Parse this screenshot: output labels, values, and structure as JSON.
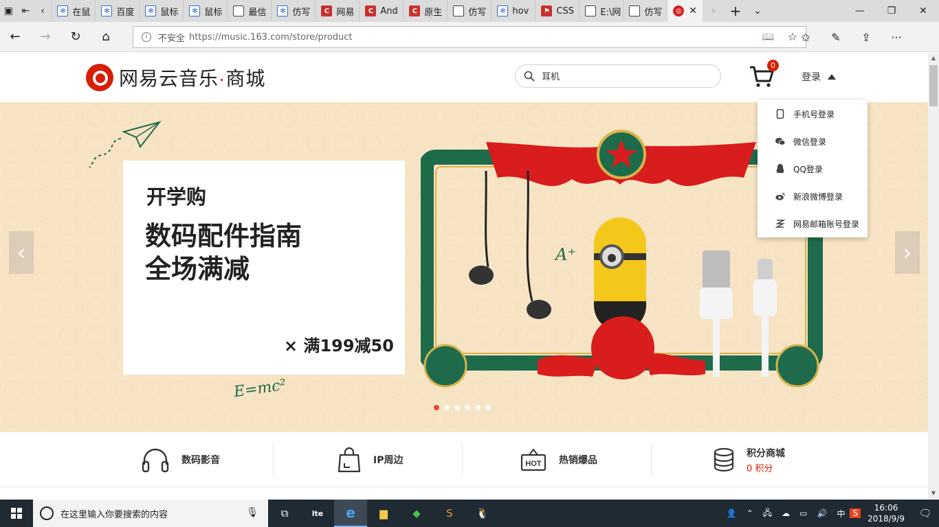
{
  "browser": {
    "tabs": [
      {
        "title": "在鼠",
        "icon": "paw"
      },
      {
        "title": "百度",
        "icon": "paw"
      },
      {
        "title": "鼠标",
        "icon": "paw"
      },
      {
        "title": "鼠标",
        "icon": "paw"
      },
      {
        "title": "最信",
        "icon": "page"
      },
      {
        "title": "仿写",
        "icon": "paw"
      },
      {
        "title": "网易",
        "icon": "csdn"
      },
      {
        "title": "And",
        "icon": "csdn"
      },
      {
        "title": "原生",
        "icon": "csdn"
      },
      {
        "title": "仿写",
        "icon": "page"
      },
      {
        "title": "hov",
        "icon": "paw"
      },
      {
        "title": "CSS",
        "icon": "ext"
      },
      {
        "title": "E:\\网",
        "icon": "page"
      },
      {
        "title": "仿写",
        "icon": "page"
      }
    ],
    "insecure_label": "不安全",
    "url": "https://music.163.com/store/product"
  },
  "site": {
    "logo_name": "网易云音乐",
    "logo_dot": "·",
    "logo_suffix": "商城",
    "search_placeholder": "耳机",
    "cart_count": "0",
    "login_label": "登录",
    "login_menu": [
      {
        "label": "手机号登录",
        "icon": "phone-icon"
      },
      {
        "label": "微信登录",
        "icon": "wechat-icon"
      },
      {
        "label": "QQ登录",
        "icon": "qq-icon"
      },
      {
        "label": "新浪微博登录",
        "icon": "weibo-icon"
      },
      {
        "label": "网易邮箱账号登录",
        "icon": "netease-mail-icon"
      }
    ]
  },
  "banner": {
    "tag": "开学购",
    "headline_1": "数码配件指南",
    "headline_2": "全场满减",
    "promo": "× 满199减50",
    "doodle_formula": "E=mc²",
    "slides": 6,
    "active_slide": 1
  },
  "categories": [
    {
      "label": "数码影音",
      "icon": "headphones-icon"
    },
    {
      "label": "IP周边",
      "icon": "bag-icon"
    },
    {
      "label": "热销爆品",
      "icon": "hot-sign-icon"
    },
    {
      "label": "积分商城",
      "icon": "coins-icon",
      "sub": "0 积分"
    }
  ],
  "taskbar": {
    "search_placeholder": "在这里输入你要搜索的内容",
    "ime": "中",
    "time": "16:06",
    "date": "2018/9/9"
  },
  "colors": {
    "brand_red": "#d81e06",
    "banner_bg": "#f7e4c4",
    "frame_green": "#1d6b4b"
  }
}
